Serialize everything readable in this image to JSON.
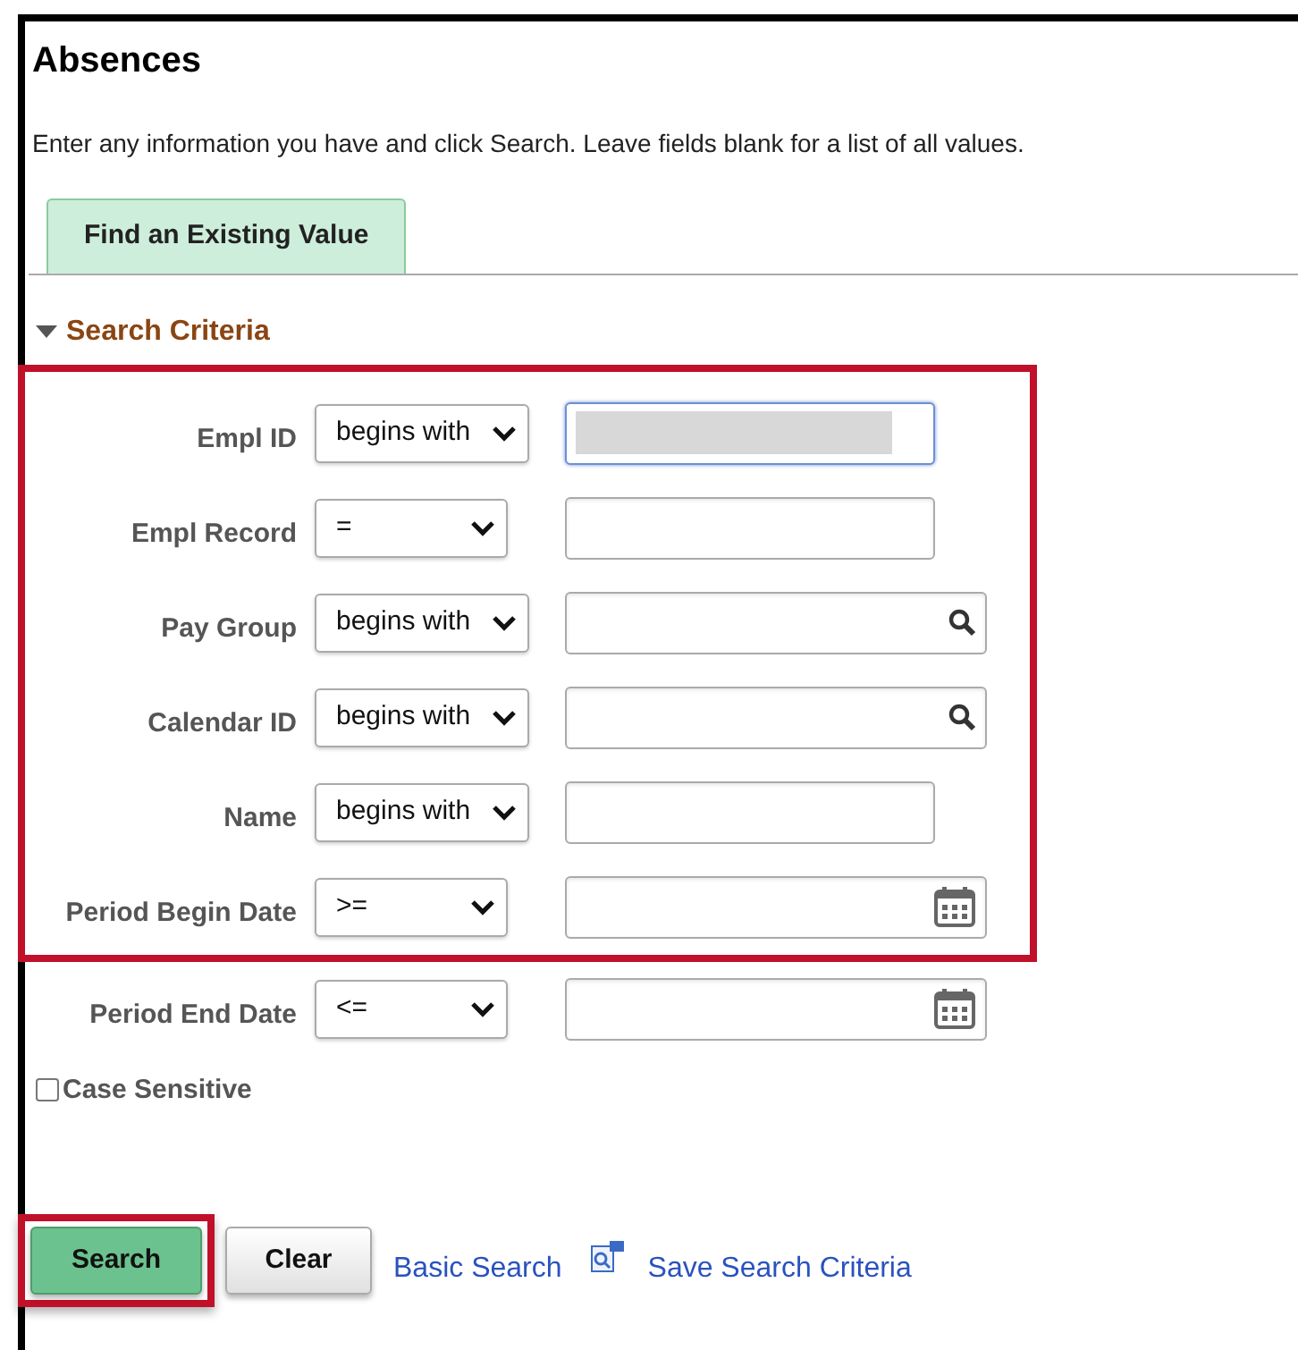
{
  "page": {
    "title": "Absences",
    "instructions": "Enter any information you have and click Search. Leave fields blank for a list of all values."
  },
  "tabs": [
    {
      "label": "Find an Existing Value",
      "selected": true
    }
  ],
  "section": {
    "title": "Search Criteria",
    "expanded": true
  },
  "criteria_groups": [
    {
      "highlighted": true,
      "rows": [
        {
          "label": "Empl ID",
          "operator": "begins with",
          "kind": "plain",
          "focused": true,
          "value_redacted": true
        },
        {
          "label": "Empl Record",
          "operator": "=",
          "kind": "plain",
          "focused": false,
          "value_redacted": false
        },
        {
          "label": "Pay Group",
          "operator": "begins with",
          "kind": "lookup",
          "focused": false,
          "value_redacted": false
        },
        {
          "label": "Calendar ID",
          "operator": "begins with",
          "kind": "lookup",
          "focused": false,
          "value_redacted": false
        },
        {
          "label": "Name",
          "operator": "begins with",
          "kind": "plain",
          "focused": false,
          "value_redacted": false
        },
        {
          "label": "Period Begin Date",
          "operator": ">=",
          "kind": "date",
          "focused": false,
          "value_redacted": false
        }
      ]
    },
    {
      "highlighted": false,
      "rows": [
        {
          "label": "Period End Date",
          "operator": "<=",
          "kind": "date",
          "focused": false,
          "value_redacted": false
        }
      ]
    }
  ],
  "case_sensitive": {
    "label": "Case Sensitive",
    "checked": false
  },
  "buttons": [
    {
      "label": "Search",
      "kind": "primary",
      "highlighted": true
    },
    {
      "label": "Clear",
      "kind": "secondary",
      "highlighted": false
    }
  ],
  "links": [
    {
      "label": "Basic Search",
      "icon": false
    },
    {
      "label": "Save Search Criteria",
      "icon": true
    }
  ]
}
